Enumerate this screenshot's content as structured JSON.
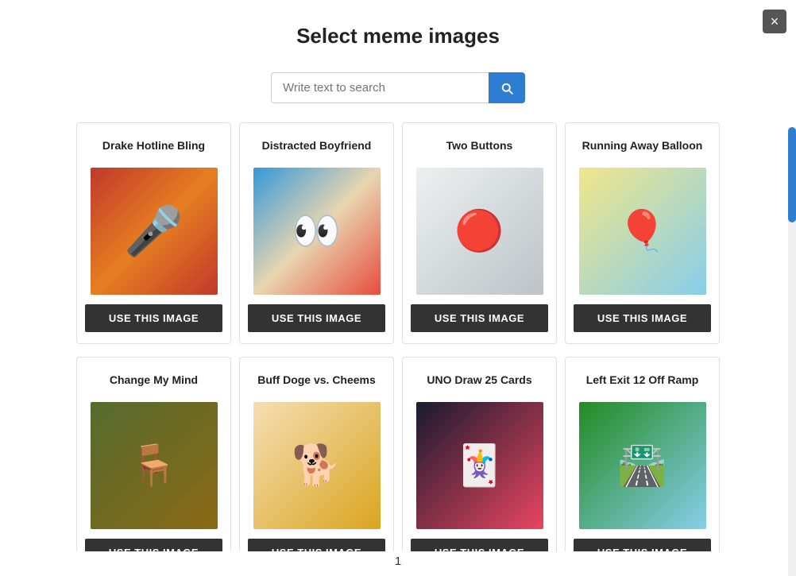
{
  "modal": {
    "title": "Select meme images",
    "close_label": "×"
  },
  "search": {
    "placeholder": "Write text to search",
    "value": ""
  },
  "pagination": {
    "current": "1"
  },
  "memes": [
    {
      "id": "drake",
      "title": "Drake Hotline Bling",
      "button_label": "USE THIS IMAGE",
      "img_class": "img-drake"
    },
    {
      "id": "distracted-boyfriend",
      "title": "Distracted Boyfriend",
      "button_label": "USE THIS IMAGE",
      "img_class": "img-boyfriend"
    },
    {
      "id": "two-buttons",
      "title": "Two Buttons",
      "button_label": "USE THIS IMAGE",
      "img_class": "img-twobuttons"
    },
    {
      "id": "running-away-balloon",
      "title": "Running Away Balloon",
      "button_label": "USE THIS IMAGE",
      "img_class": "img-running"
    },
    {
      "id": "change-my-mind",
      "title": "Change My Mind",
      "button_label": "USE THIS IMAGE",
      "img_class": "img-changemymind"
    },
    {
      "id": "buff-doge",
      "title": "Buff Doge vs. Cheems",
      "button_label": "USE THIS IMAGE",
      "img_class": "img-buffdoge"
    },
    {
      "id": "uno-draw",
      "title": "UNO Draw 25 Cards",
      "button_label": "USE THIS IMAGE",
      "img_class": "img-unodraw"
    },
    {
      "id": "left-exit",
      "title": "Left Exit 12 Off Ramp",
      "button_label": "USE THIS IMAGE",
      "img_class": "img-leftexit"
    }
  ]
}
